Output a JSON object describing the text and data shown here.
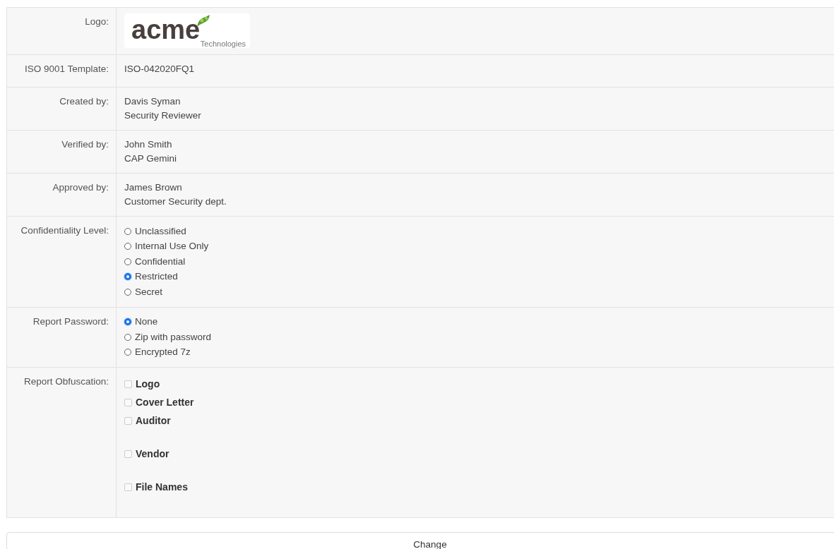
{
  "rows": [
    {
      "kind": "logo",
      "label": "Logo:",
      "logo": {
        "word": "acme",
        "tagline": "Technologies"
      }
    },
    {
      "kind": "text",
      "label": "ISO 9001 Template:",
      "lines": [
        "ISO-042020FQ1"
      ]
    },
    {
      "kind": "text",
      "label": "Created by:",
      "lines": [
        "Davis Syman",
        "Security Reviewer"
      ]
    },
    {
      "kind": "text",
      "label": "Verified by:",
      "lines": [
        "John Smith",
        "CAP Gemini"
      ]
    },
    {
      "kind": "text",
      "label": "Approved by:",
      "lines": [
        "James Brown",
        "Customer Security dept."
      ]
    },
    {
      "kind": "radio",
      "label": "Confidentiality Level:",
      "options": [
        {
          "label": "Unclassified",
          "selected": false
        },
        {
          "label": "Internal Use Only",
          "selected": false
        },
        {
          "label": "Confidential",
          "selected": false
        },
        {
          "label": "Restricted",
          "selected": true
        },
        {
          "label": "Secret",
          "selected": false
        }
      ]
    },
    {
      "kind": "radio",
      "label": "Report Password:",
      "options": [
        {
          "label": "None",
          "selected": true
        },
        {
          "label": "Zip with password",
          "selected": false
        },
        {
          "label": "Encrypted 7z",
          "selected": false
        }
      ]
    },
    {
      "kind": "checkbox",
      "label": "Report Obfuscation:",
      "options": [
        {
          "label": "Logo",
          "checked": false
        },
        {
          "label": "Cover Letter",
          "checked": false
        },
        {
          "label": "Auditor",
          "checked": false
        },
        {
          "label": "Vendor",
          "checked": false
        },
        {
          "label": "File Names",
          "checked": false
        }
      ]
    }
  ],
  "button": "Change"
}
